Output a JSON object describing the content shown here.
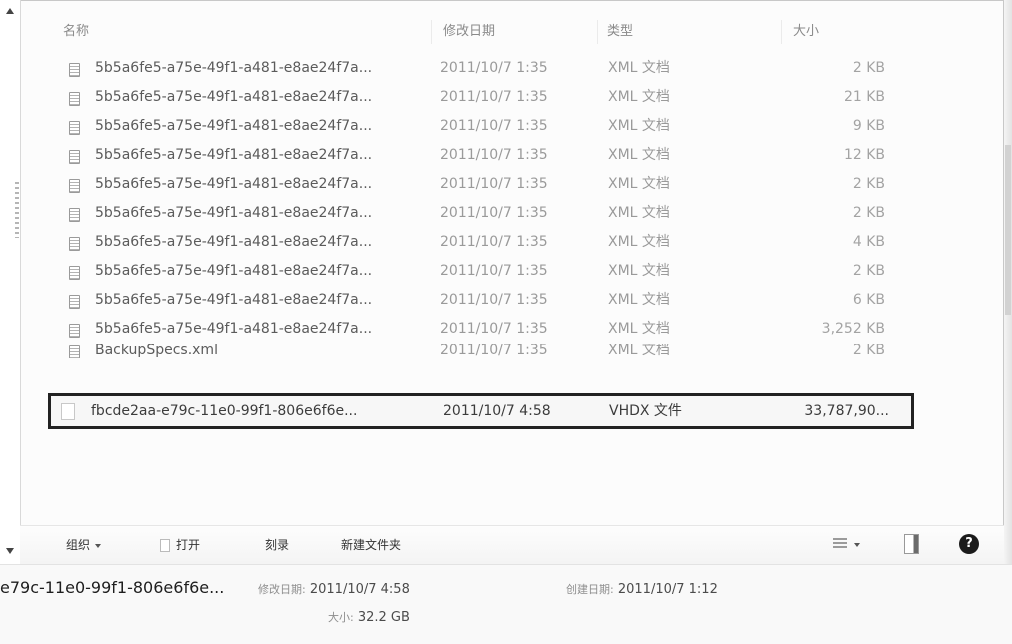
{
  "columns": {
    "name": "名称",
    "date": "修改日期",
    "type": "类型",
    "size": "大小"
  },
  "files": [
    {
      "name": "5b5a6fe5-a75e-49f1-a481-e8ae24f7a...",
      "date": "2011/10/7 1:35",
      "type": "XML 文档",
      "size": "2 KB"
    },
    {
      "name": "5b5a6fe5-a75e-49f1-a481-e8ae24f7a...",
      "date": "2011/10/7 1:35",
      "type": "XML 文档",
      "size": "21 KB"
    },
    {
      "name": "5b5a6fe5-a75e-49f1-a481-e8ae24f7a...",
      "date": "2011/10/7 1:35",
      "type": "XML 文档",
      "size": "9 KB"
    },
    {
      "name": "5b5a6fe5-a75e-49f1-a481-e8ae24f7a...",
      "date": "2011/10/7 1:35",
      "type": "XML 文档",
      "size": "12 KB"
    },
    {
      "name": "5b5a6fe5-a75e-49f1-a481-e8ae24f7a...",
      "date": "2011/10/7 1:35",
      "type": "XML 文档",
      "size": "2 KB"
    },
    {
      "name": "5b5a6fe5-a75e-49f1-a481-e8ae24f7a...",
      "date": "2011/10/7 1:35",
      "type": "XML 文档",
      "size": "2 KB"
    },
    {
      "name": "5b5a6fe5-a75e-49f1-a481-e8ae24f7a...",
      "date": "2011/10/7 1:35",
      "type": "XML 文档",
      "size": "4 KB"
    },
    {
      "name": "5b5a6fe5-a75e-49f1-a481-e8ae24f7a...",
      "date": "2011/10/7 1:35",
      "type": "XML 文档",
      "size": "2 KB"
    },
    {
      "name": "5b5a6fe5-a75e-49f1-a481-e8ae24f7a...",
      "date": "2011/10/7 1:35",
      "type": "XML 文档",
      "size": "6 KB"
    },
    {
      "name": "5b5a6fe5-a75e-49f1-a481-e8ae24f7a...",
      "date": "2011/10/7 1:35",
      "type": "XML 文档",
      "size": "3,252 KB"
    },
    {
      "name": "BackupSpecs.xml",
      "date": "2011/10/7 1:35",
      "type": "XML 文档",
      "size": "2 KB"
    }
  ],
  "selected_file": {
    "name": "fbcde2aa-e79c-11e0-99f1-806e6f6e...",
    "date": "2011/10/7 4:58",
    "type": "VHDX 文件",
    "size": "33,787,90..."
  },
  "toolbar": {
    "organize": "组织",
    "open": "打开",
    "burn": "刻录",
    "new_folder": "新建文件夹",
    "help_glyph": "?"
  },
  "details": {
    "name": "e79c-11e0-99f1-806e6f6e...",
    "modified_label": "修改日期:",
    "modified_value": "2011/10/7 4:58",
    "created_label": "创建日期:",
    "created_value": "2011/10/7 1:12",
    "size_label": "大小:",
    "size_value": "32.2 GB"
  },
  "icons": [
    "scroll-up-icon",
    "scroll-down-icon",
    "xml-file-icon",
    "vhdx-file-icon",
    "view-options-icon",
    "preview-pane-icon",
    "help-icon"
  ]
}
